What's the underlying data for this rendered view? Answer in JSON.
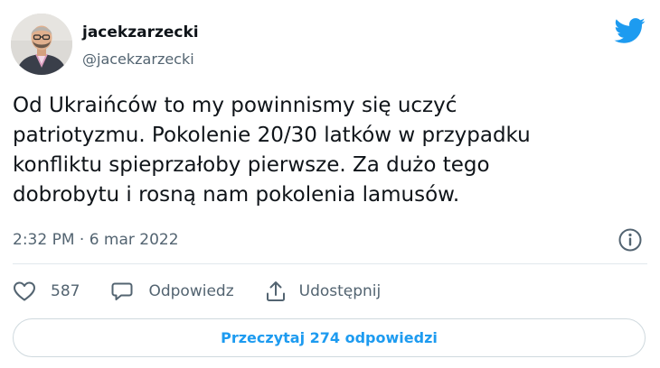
{
  "author": {
    "display_name": "jacekzarzecki",
    "handle": "@jacekzarzecki"
  },
  "tweet": {
    "text": "Od Ukraińców to my  powinnismy się uczyć\npatriotyzmu. Pokolenie  20/30 latków w przypadku\nkonfliktu spieprzałoby pierwsze. Za dużo tego\ndobrobytu i rosną nam pokolenia lamusów.",
    "timestamp": "2:32 PM · 6 mar 2022"
  },
  "actions": {
    "like_count": "587",
    "reply_label": "Odpowiedz",
    "share_label": "Udostępnij"
  },
  "read_replies_label": "Przeczytaj 274 odpowiedzi",
  "icons": {
    "brand": "twitter-bird-icon",
    "info": "info-icon",
    "like": "heart-icon",
    "reply": "speech-bubble-icon",
    "share": "share-upload-icon"
  },
  "colors": {
    "brand": "#1d9bf0",
    "text": "#0f1419",
    "secondary_text": "#536471",
    "border": "#cfd9de"
  }
}
